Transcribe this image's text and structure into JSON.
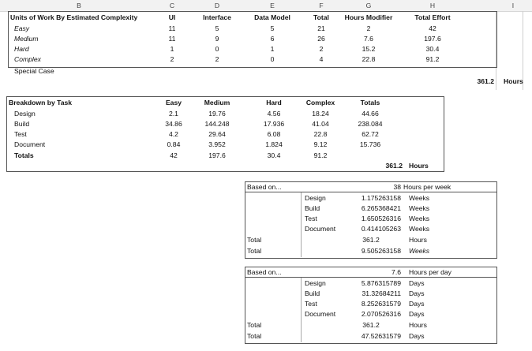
{
  "columns": [
    "B",
    "C",
    "D",
    "E",
    "F",
    "G",
    "H",
    "I"
  ],
  "complexity": {
    "headers": [
      "Units of Work By Estimated Complexity",
      "UI",
      "Interface",
      "Data Model",
      "Total",
      "Hours Modifier",
      "Total Effort"
    ],
    "rows": [
      [
        "Easy",
        "11",
        "5",
        "5",
        "21",
        "2",
        "42"
      ],
      [
        "Medium",
        "11",
        "9",
        "6",
        "26",
        "7.6",
        "197.6"
      ],
      [
        "Hard",
        "1",
        "0",
        "1",
        "2",
        "15.2",
        "30.4"
      ],
      [
        "Complex",
        "2",
        "2",
        "0",
        "4",
        "22.8",
        "91.2"
      ]
    ],
    "special_case": "Special Case",
    "total_value": "361.2",
    "total_unit": "Hours"
  },
  "breakdown": {
    "headers": [
      "Breakdown by Task",
      "Easy",
      "Medium",
      "Hard",
      "Complex",
      "Totals"
    ],
    "rows": [
      [
        "Design",
        "2.1",
        "19.76",
        "4.56",
        "18.24",
        "44.66"
      ],
      [
        "Build",
        "34.86",
        "144.248",
        "17.936",
        "41.04",
        "238.084"
      ],
      [
        "Test",
        "4.2",
        "29.64",
        "6.08",
        "22.8",
        "62.72"
      ],
      [
        "Document",
        "0.84",
        "3.952",
        "1.824",
        "9.12",
        "15.736"
      ]
    ],
    "totals_row": [
      "Totals",
      "42",
      "197.6",
      "30.4",
      "91.2",
      ""
    ],
    "total_value": "361.2",
    "total_unit": "Hours"
  },
  "weekly": {
    "based_on": "Based on...",
    "value": "38",
    "unit": "Hours per week",
    "rows": [
      [
        "Design",
        "1.175263158",
        "Weeks"
      ],
      [
        "Build",
        "6.265368421",
        "Weeks"
      ],
      [
        "Test",
        "1.650526316",
        "Weeks"
      ],
      [
        "Document",
        "0.414105263",
        "Weeks"
      ]
    ],
    "total_hours": [
      "Total",
      "361.2",
      "Hours"
    ],
    "total_weeks": [
      "Total",
      "9.505263158",
      "Weeks"
    ]
  },
  "daily": {
    "based_on": "Based on...",
    "value": "7.6",
    "unit": "Hours per day",
    "rows": [
      [
        "Design",
        "5.876315789",
        "Days"
      ],
      [
        "Build",
        "31.32684211",
        "Days"
      ],
      [
        "Test",
        "8.252631579",
        "Days"
      ],
      [
        "Document",
        "2.070526316",
        "Days"
      ]
    ],
    "total_hours": [
      "Total",
      "361.2",
      "Hours"
    ],
    "total_days": [
      "Total",
      "47.52631579",
      "Days"
    ]
  }
}
